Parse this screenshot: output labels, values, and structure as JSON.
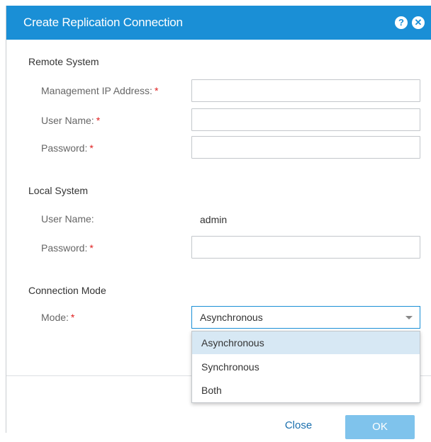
{
  "dialog": {
    "title": "Create Replication Connection",
    "icons": {
      "help": "?",
      "close": "✕"
    }
  },
  "remote_system": {
    "heading": "Remote System",
    "management_ip_label": "Management IP Address:",
    "management_ip_value": "",
    "user_name_label": "User Name:",
    "user_name_value": "",
    "password_label": "Password:",
    "password_value": "",
    "required_mark": "*"
  },
  "local_system": {
    "heading": "Local System",
    "user_name_label": "User Name:",
    "user_name_value": "admin",
    "password_label": "Password:",
    "password_value": "",
    "required_mark": "*"
  },
  "connection_mode": {
    "heading": "Connection Mode",
    "mode_label": "Mode:",
    "required_mark": "*",
    "selected": "Asynchronous",
    "options": [
      "Asynchronous",
      "Synchronous",
      "Both"
    ]
  },
  "footer": {
    "close_label": "Close",
    "ok_label": "OK"
  },
  "colors": {
    "titlebar": "#1a8fd6",
    "required": "#e02020",
    "ok_disabled": "#7fc3ec",
    "option_highlight": "#d7e8f4"
  }
}
